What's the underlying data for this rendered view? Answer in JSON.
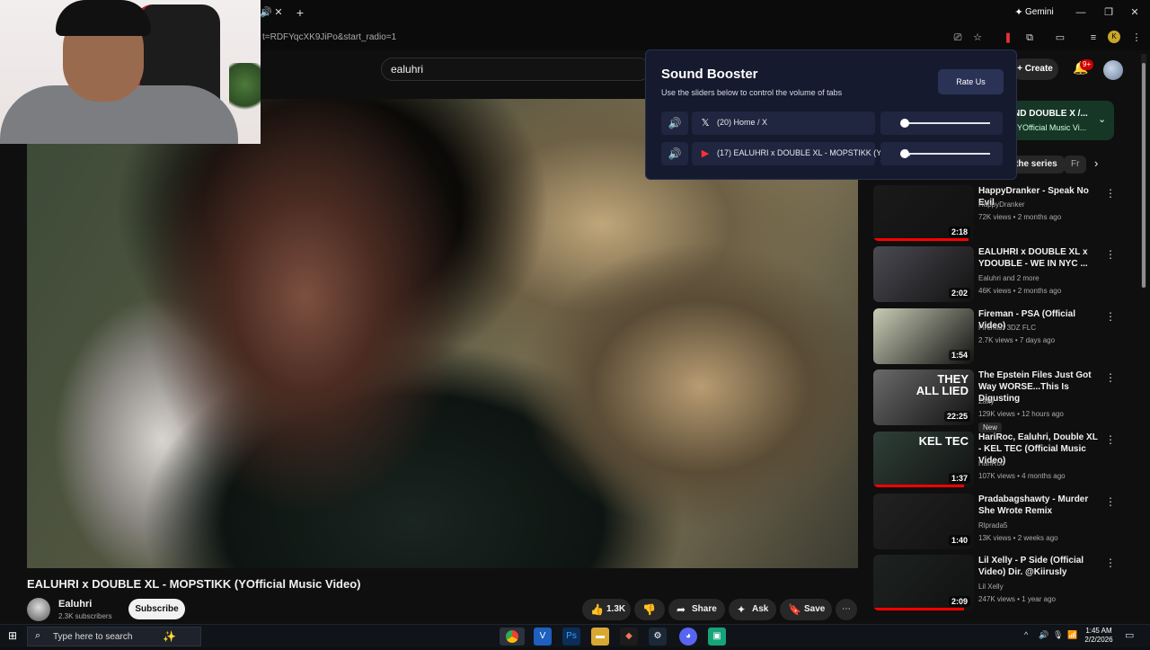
{
  "browser": {
    "url": "t=RDFYqcXK9JiPo&start_radio=1",
    "gemini_label": "Gemini",
    "new_tab_icon": "plus-icon"
  },
  "youtube": {
    "search_value": "ealuhri",
    "create_label": "Create",
    "notif_count": "9+",
    "now_playing_title": "ND DOUBLE X /...",
    "now_playing_sub": "YOfficial Music Vi...",
    "chips": [
      "the series",
      "Fr"
    ]
  },
  "sound_booster": {
    "title": "Sound Booster",
    "subtitle": "Use the sliders below to control the volume of tabs",
    "rate_label": "Rate Us",
    "rows": [
      {
        "tab": "(20) Home / X",
        "icon": "x-logo-icon",
        "volume": 0.0
      },
      {
        "tab": "(17) EALUHRI x DOUBLE XL - MOPSTIKK (Y...",
        "icon": "youtube-logo-icon",
        "volume": 0.0
      }
    ]
  },
  "video": {
    "title": "EALUHRI x DOUBLE XL - MOPSTIKK (YOfficial Music Video)",
    "channel": "Ealuhri",
    "subscribers": "2.3K subscribers",
    "subscribe_label": "Subscribe",
    "likes": "1.3K",
    "share_label": "Share",
    "ask_label": "Ask",
    "save_label": "Save"
  },
  "recommendations": [
    {
      "title": "HappyDranker - Speak No Evil",
      "channel": "HappyDranker",
      "meta": "72K views • 2 months ago",
      "duration": "2:18",
      "progress": 0.95,
      "thumb": "#1a1a1a"
    },
    {
      "title": "EALUHRI x DOUBLE XL x YDOUBLE - WE IN NYC ...",
      "channel": "Ealuhri and 2 more",
      "meta": "46K views • 2 months ago",
      "duration": "2:02",
      "progress": 0,
      "thumb": "#4a4a52"
    },
    {
      "title": "Fireman - PSA (Official Video)",
      "channel": "Fireman 3DZ FLC",
      "meta": "2.7K views • 7 days ago",
      "duration": "1:54",
      "progress": 0,
      "thumb": "#c8ccb4"
    },
    {
      "title": "The Epstein Files Just Got Way WORSE...This Is Digusting",
      "channel": "Zaffy",
      "meta": "129K views • 12 hours ago",
      "badge": "New",
      "duration": "22:25",
      "progress": 0,
      "thumb": "#6a6a6a",
      "overlay": "THEY ALL LIED"
    },
    {
      "title": "HariRoc, Ealuhri, Double XL - KEL TEC (Official Music Video)",
      "channel": "HariRoc",
      "meta": "107K views • 4 months ago",
      "duration": "1:37",
      "progress": 0.9,
      "thumb": "#2f4038",
      "overlay": "KEL TEC"
    },
    {
      "title": "Pradabagshawty - Murder She Wrote Remix",
      "channel": "Rlprada5",
      "meta": "13K views • 2 weeks ago",
      "duration": "1:40",
      "progress": 0,
      "thumb": "#222"
    },
    {
      "title": "Lil Xelly - P Side (Official Video) Dir. @Kiirusly",
      "channel": "Lil Xelly",
      "meta": "247K views • 1 year ago",
      "duration": "2:09",
      "progress": 0.9,
      "thumb": "#1d2320"
    }
  ],
  "taskbar": {
    "search_placeholder": "Type here to search",
    "time": "1:45 AM",
    "date": "2/2/2026"
  }
}
